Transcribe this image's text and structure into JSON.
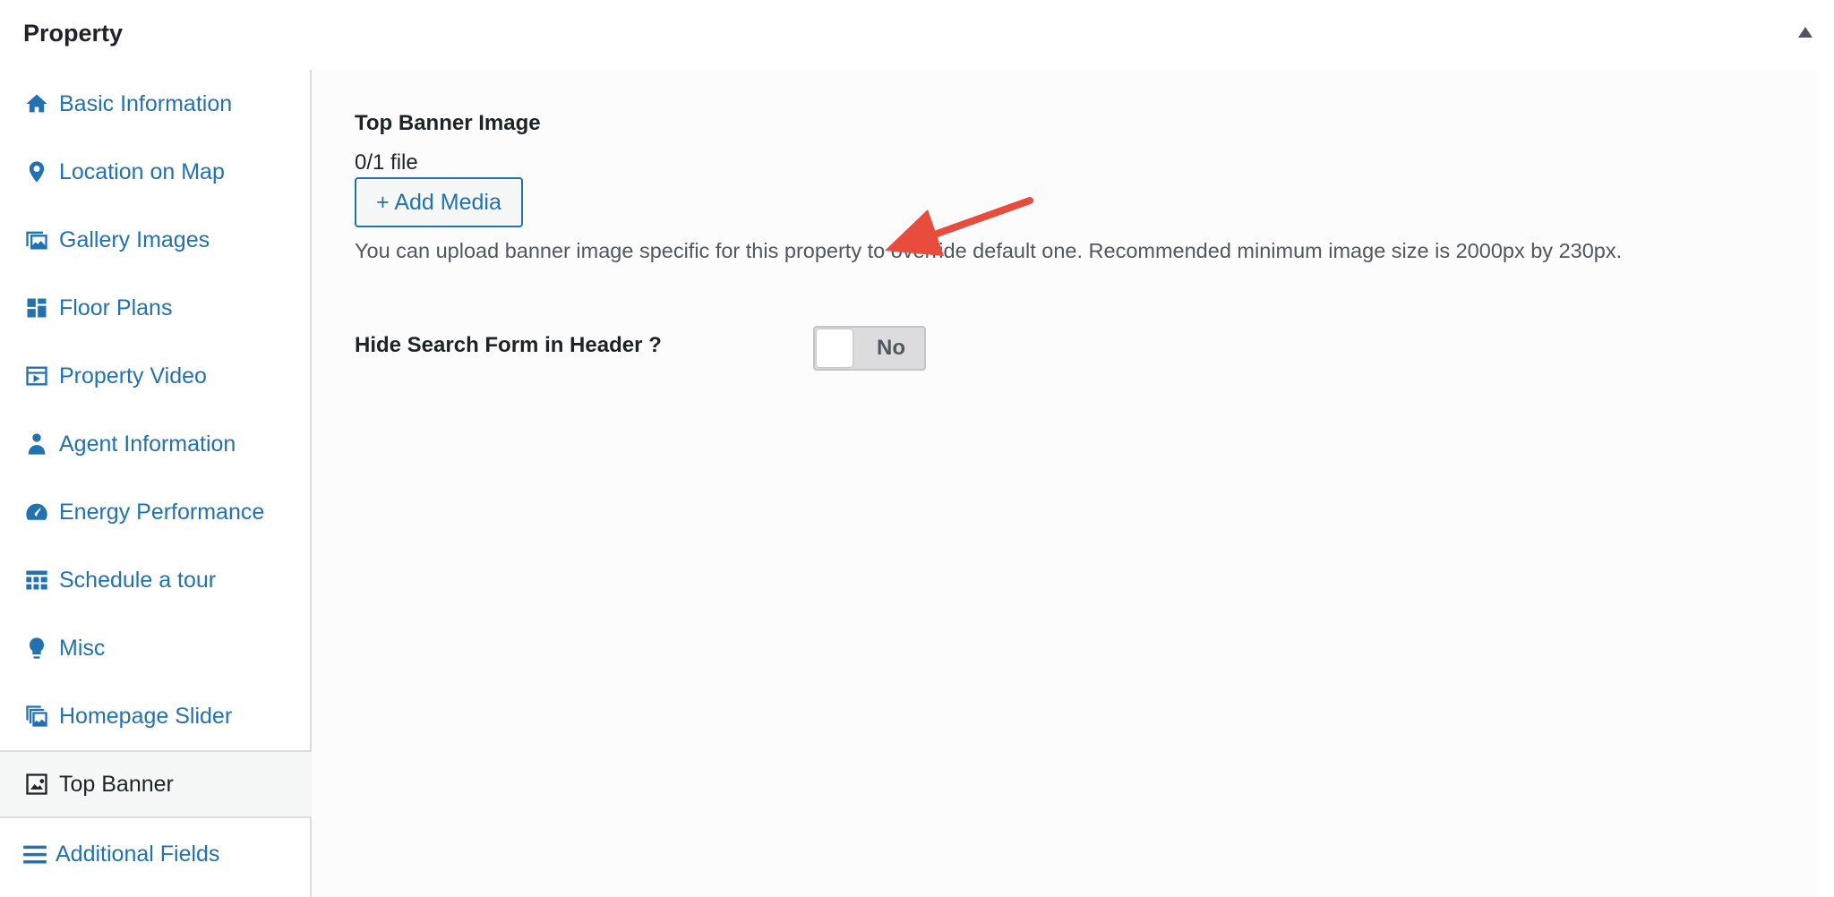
{
  "panel": {
    "title": "Property"
  },
  "sidebar": {
    "items": [
      {
        "label": "Basic Information",
        "icon": "home-icon"
      },
      {
        "label": "Location on Map",
        "icon": "map-pin-icon"
      },
      {
        "label": "Gallery Images",
        "icon": "gallery-icon"
      },
      {
        "label": "Floor Plans",
        "icon": "floor-plan-icon"
      },
      {
        "label": "Property Video",
        "icon": "video-icon"
      },
      {
        "label": "Agent Information",
        "icon": "agent-icon"
      },
      {
        "label": "Energy Performance",
        "icon": "gauge-icon"
      },
      {
        "label": "Schedule a tour",
        "icon": "calendar-grid-icon"
      },
      {
        "label": "Misc",
        "icon": "lightbulb-icon"
      },
      {
        "label": "Homepage Slider",
        "icon": "slider-icon"
      },
      {
        "label": "Top Banner",
        "icon": "image-icon",
        "active": true
      },
      {
        "label": "Additional Fields",
        "icon": "menu-lines-icon"
      }
    ]
  },
  "top_banner": {
    "field_title": "Top Banner Image",
    "file_count": "0/1 file",
    "add_media_label": "+ Add Media",
    "description": "You can upload banner image specific for this property to override default one. Recommended minimum image size is 2000px by 230px."
  },
  "hide_search": {
    "label": "Hide Search Form in Header ?",
    "toggle_text": "No",
    "checked": false
  },
  "colors": {
    "link": "#2271b1",
    "text": "#1d2327",
    "arrow": "#e74c3c"
  }
}
